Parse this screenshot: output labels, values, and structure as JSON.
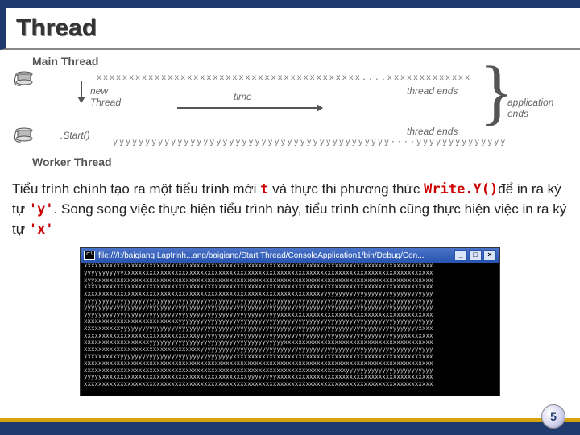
{
  "title": "Thread",
  "diagram": {
    "mainThread": "Main Thread",
    "workerThread": "Worker Thread",
    "newThread": "new\nThread",
    "start": ".Start()",
    "time": "time",
    "threadEnds1": "thread ends",
    "threadEnds2": "thread ends",
    "appEnds": "application\nends",
    "xxx": "xxxxxxxxxxxxxxxxxxxxxxxxxxxxxxxxxxxxxxxxx....xxxxxxxxxxxxx",
    "yyy": "yyyyyyyyyyyyyyyyyyyyyyyyyyyyyyyyyyyyyyyyyyy····yyyyyyyyyyyyyy"
  },
  "desc": {
    "pre_t": "Tiểu trình chính tạo ra một tiểu trình mới ",
    "t": "t",
    "post_t": " và thực thi phương thức ",
    "writey": "Write.Y()",
    "post_writey": "để in ra ký tự ",
    "y": "'y'",
    "post_y": ". Song song việc thực hiện tiểu trình này, tiểu trình chính cũng thực hiện việc in ra ký tự ",
    "x": "'x'"
  },
  "console": {
    "path": "file:///I:/baigiang Laptrinh...ang/baigiang/Start Thread/ConsoleApplication1/bin/Debug/Con...",
    "l1": "xxxxxxxxxxxxxxxxxxxxxxxxxxxxxxxxxxxxxxxxxxxxxxxxxxxxxxxxxxxxxxxxxxxxxxxxxxxxxxxxxxxxxxxxxxxxxxxx",
    "l2": "yyyyyyyyyyyxxxxxxxxxxxxxxxxxxxxxxxxxxxxxxxxxxxxxxxxxxxxxxxxxxxxxxxxxxxxxxxxxxxxxxxxxxxxxxxxxxxxx",
    "l3": "xyyxxxxxxxxxxxxxxxxxxxxxxxxxxxxxxxxxxxxxxxxxxxxxxxxxxxxxxxxxxxxxxxxxxxxxxxxxxxxxxxxxxxxxxxxxxxxx",
    "l4": "xxxxxxxxxxxxxxxxxxxxxxxxxxxxxxxxxxxxxxxxxxxxxxxxxxxxxxxxxxxxxxxxxxxxxxxxxxxxxxxxxxxxxxxxxxxxxxxx",
    "l5": "xxxxxxxxxxxxxxxxxxxxxxxxxxxxxxxxxxxxxxxxxxxxxxxxxxxxxxxxxxxxxxxxxyyyyyyyyyyyyyyyyyyyyyyyyyyyyyyy",
    "l6": "yyyyyyyyyyyyyyyyyyyyyyyyyyyyyyyyyyyyyyyyyyyyyyyyyyyyyyyyyyyyyyyyyyyyyyyyyyyyyyyyyyyyyyyyyyyyyyyy",
    "l7": "yyyyyyyyyyyyyyyyyyyyyyyyyyyyyyyyyyyyyyyyyyyyyyyyyyyyyyyyyyyyyyyyyyyyyyyyyyyyyyyyyyyyyyyyyyyyyyyy",
    "l8": "yyyyyyyyyyyyyyyyyyyyyyyyyyyyyyyyyyyyyyyyyyyyyyyyyyyyyyxxxxxxxxxxxxxxxxxxxxxxxxxxxxxxxxxxxxxxxxxx",
    "l9": "xxxxxxxxxxxxxxxxxxxxxxxxxxyyyyyyyyyyyyyyyyyyyyyyyyyyyyyyyyyyyyyyyyyyyyyyyyyyyyyyyyyyyyyyyyyyyyyy",
    "l10": "xxxxxxxxxxyyyyyyyyyyyyyyyyyyyyyyyyyyyyyyyyyyyyyyyyyyyyyyyyyyyyyyyyyyyyyyyyyyyyyyyyyyyyyyyyyyxxxx",
    "l11": "xxxxxxxxxxxxxxxxxxxxxxxxxxxxxxxyyyyyyyyyyyyyyyyyyyyyyyyyyyyyyyyyyyyyyyyyyyyyyyyyyyyyyyyyxxxxxxxx",
    "l12": "xxxxxxxxxxxxxxxxxxyyyyyyyyyyyyyyyyyyyyyyyyyyyyyyyyyyyyyxxxxxxxxxxxxxxxxxxxxxxxxxxxxxxxxxxxxxxxxx",
    "l13": "xxxxxxxxxxxxxxxxxxxxxxxxxxxxxxxxyyyyyyyyyyyyyyyyyyyyyyyyyyyyyyyyyyyyyyyyyyyyyyyyyyyyyyyyyyyyyyyy",
    "l14": "xxxxxxxxxxyyyyyyyyyyyyyyyyyyyyyyyyyyyyyyyxxxxxxxxxxxxxxxxxxxxxxxxxxxxxxxxxxxxxxxxxxxxxxxxxxxxxxx",
    "l15": "xxxxxxxxxxxxxxxxxxxxxxxxxxxxxxxxxxxxxxxxxxxxxxxxxxxxxxxxxxxxxxxxxxxxxxxxxxxxxxxxxxxxxxxxxxxxxxxx",
    "l16": "xxxxxxxxxxxxxxxxxxxxxxxxxxxxxxxxxxxxxxxxxxxxxxxxxxxxxxxxxxxxxxxxxxxxxxxxyyyyyyyyyyyyyyyyyyyyyyyy",
    "l17": "yyyyyxxxxxxxxxxxxxxxxxxxxxxxxxxxxxxxxxxxxxxxxyyyyyyyyxxxxxxxxxxxxxxxxxxxxxxxxxxxxxxxxxxxxxxxxxxx",
    "l18": "xxxxxxxxxxxxxxxxxxxxxxxxxxxxxxxxxxxxxxxxxxxxxxxxxxxxxxxxxxxxxxxxxxxxxxxxxxxxxxxxxxxxxxxxxxxxxxxx"
  },
  "pageNum": "5"
}
